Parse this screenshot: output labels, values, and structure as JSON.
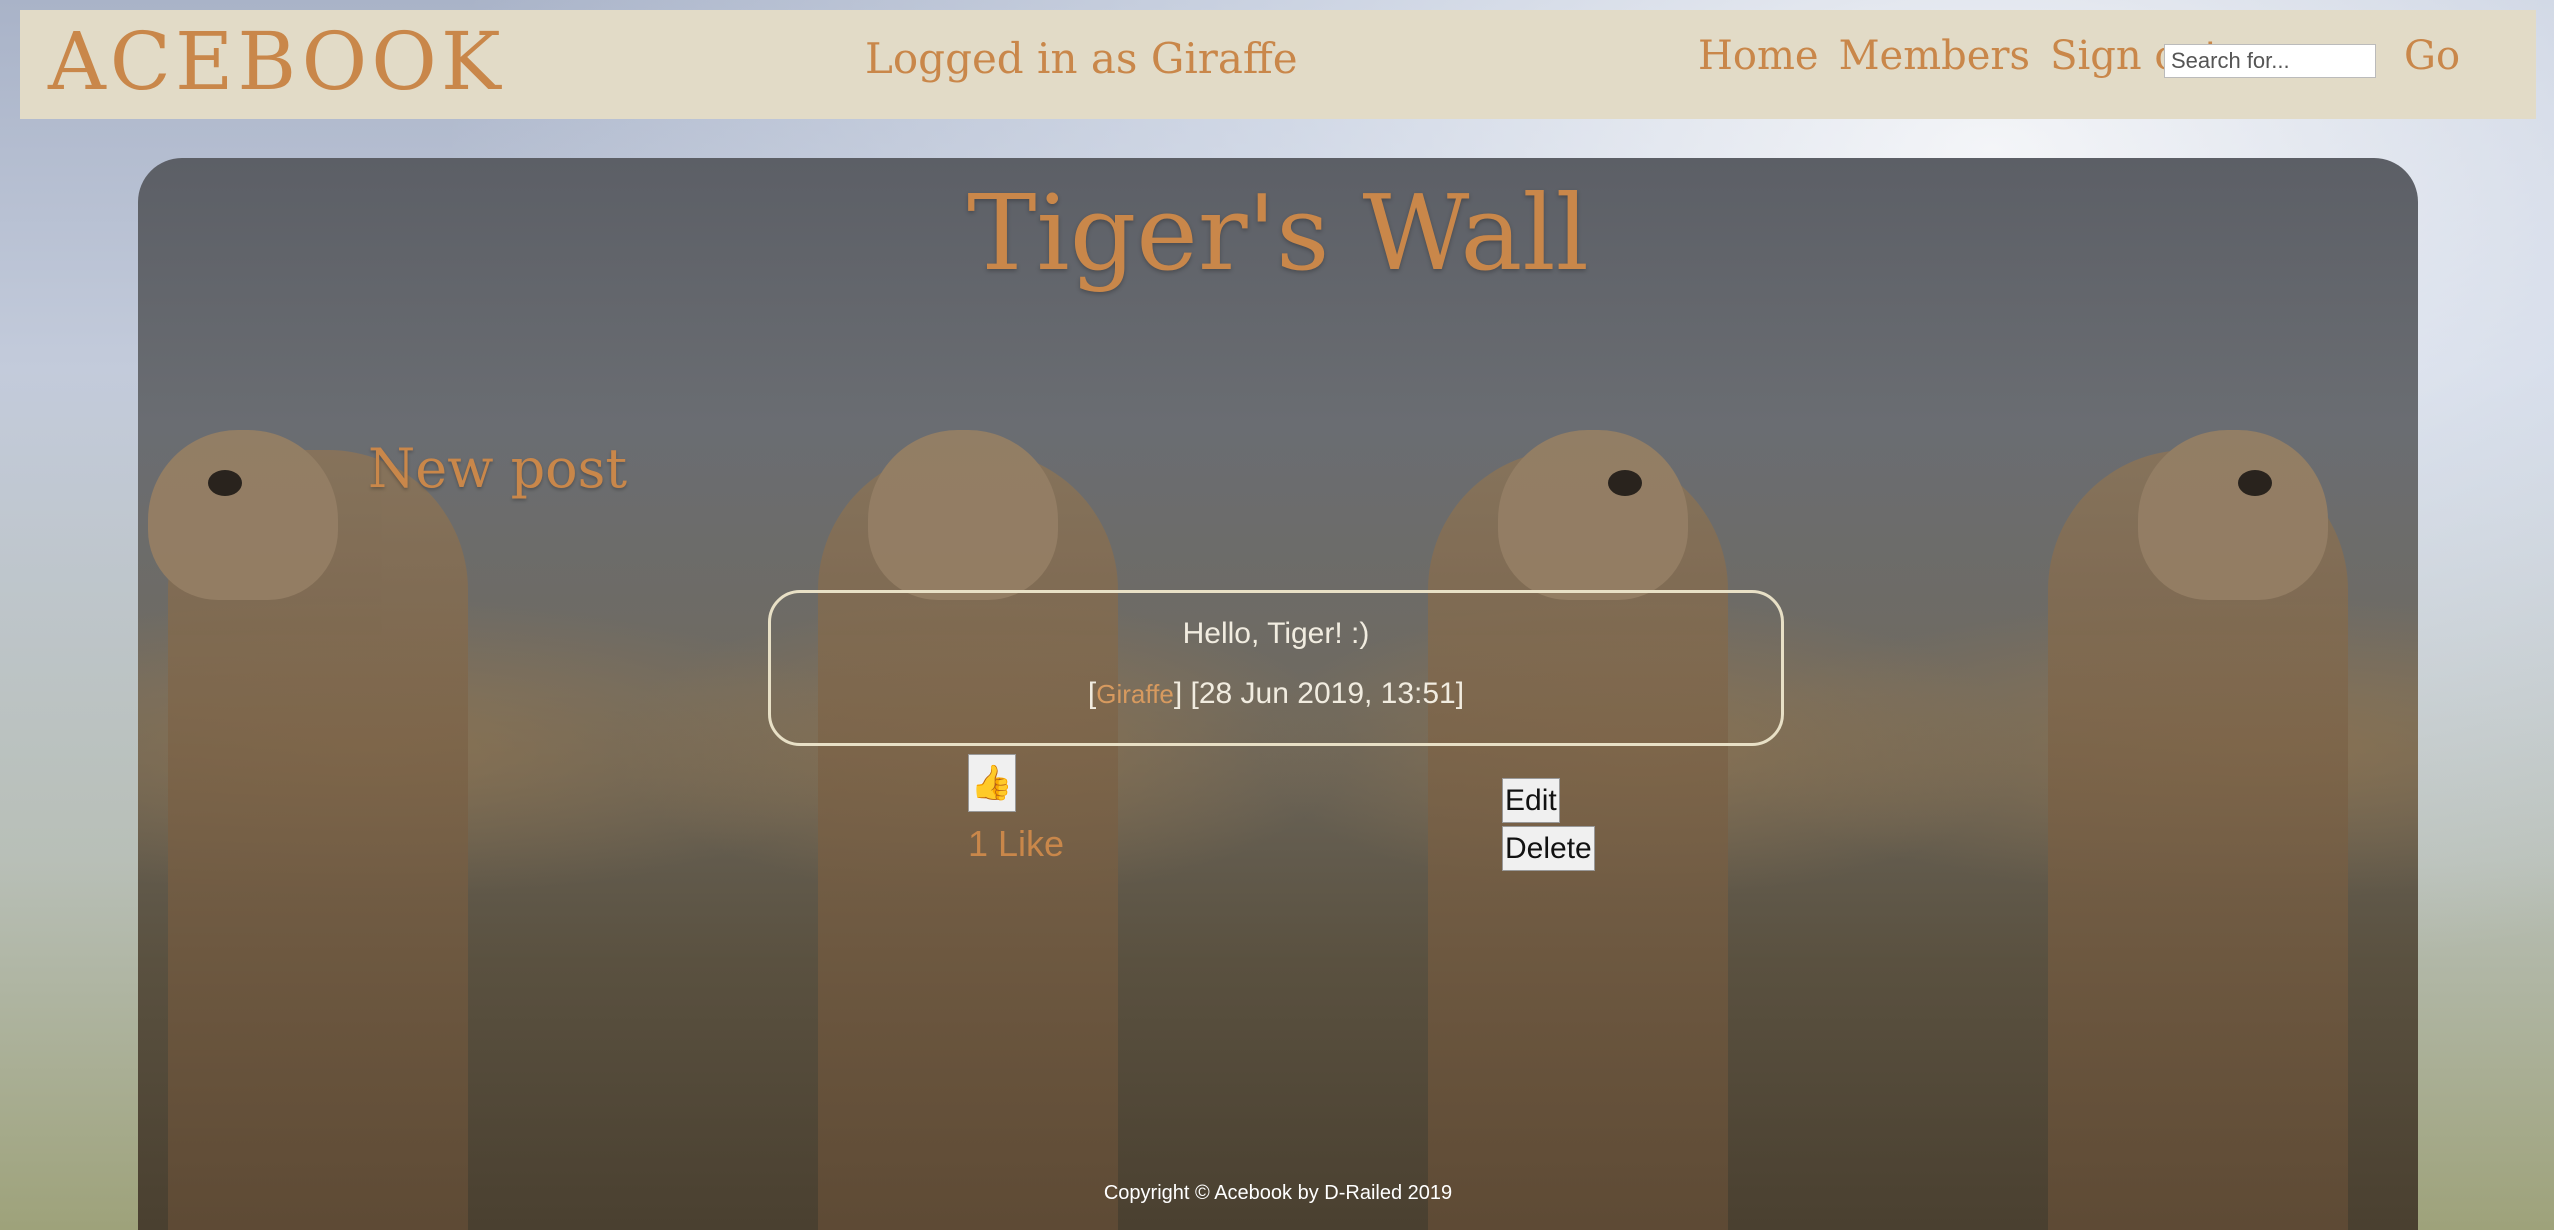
{
  "navbar": {
    "brand": "ACEBOOK",
    "logged_in_text": "Logged in as Giraffe",
    "links": [
      "Home",
      "Members",
      "Sign out"
    ],
    "search_placeholder": "Search for...",
    "search_button": "Go"
  },
  "wall": {
    "title": "Tiger's Wall",
    "new_post_label": "New post"
  },
  "post": {
    "message": "Hello, Tiger! :)",
    "author_prefix": "[",
    "author": "Giraffe",
    "author_suffix": "]",
    "timestamp": "[28 Jun 2019, 13:51]",
    "like_icon": "thumbs-up-icon",
    "like_count_text": "1 Like",
    "edit_label": "Edit",
    "delete_label": "Delete"
  },
  "footer": {
    "copyright": "Copyright © Acebook by D-Railed 2019"
  },
  "colors": {
    "accent": "#c9874a",
    "navbar_bg": "#e2dbc7",
    "post_border": "#e8e0c6"
  }
}
